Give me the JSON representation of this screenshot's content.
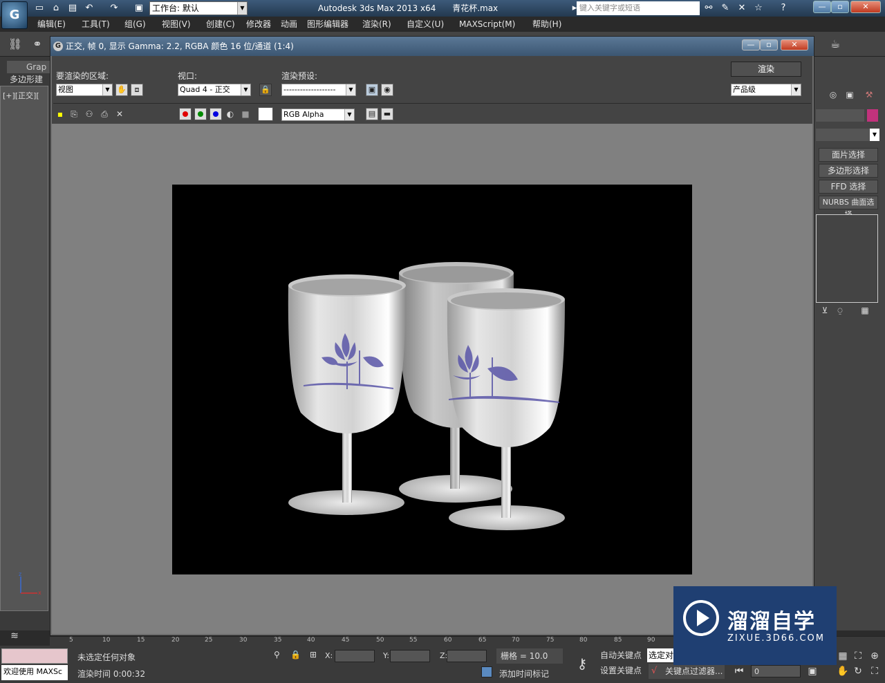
{
  "title_bar": {
    "workspace_label": "工作台: 默认",
    "app_name": "Autodesk 3ds Max  2013 x64",
    "file_name": "青花杯.max",
    "search_placeholder": "键入关键字或短语"
  },
  "menu": {
    "items": [
      "编辑(E)",
      "工具(T)",
      "组(G)",
      "视图(V)",
      "创建(C)",
      "修改器",
      "动画",
      "图形编辑器",
      "渲染(R)",
      "自定义(U)",
      "MAXScript(M)",
      "帮助(H)"
    ]
  },
  "left_panel": {
    "graphite_tab": "Grap",
    "poly_label": "多边形建",
    "viewport_label": "[+][正交]["
  },
  "right_panel": {
    "buttons": [
      "面片选择",
      "多边形选择",
      "FFD 选择",
      "NURBS 曲面选择"
    ]
  },
  "render_window": {
    "title": "正交, 帧 0, 显示 Gamma: 2.2, RGBA 颜色 16 位/通道 (1:4)",
    "area_label": "要渲染的区域:",
    "area_value": "视图",
    "viewport_label": "视口:",
    "viewport_value": "Quad 4 - 正交",
    "preset_label": "渲染预设:",
    "preset_value": "-------------------",
    "render_button": "渲染",
    "quality_value": "产品级",
    "channel_value": "RGB Alpha",
    "channel_colors": {
      "red": "#e00000",
      "green": "#008a00",
      "blue": "#0000e0"
    }
  },
  "timeline": {
    "ticks": [
      "5",
      "10",
      "15",
      "20",
      "25",
      "30",
      "35",
      "40",
      "45",
      "50",
      "55",
      "60",
      "65",
      "70",
      "75",
      "80",
      "85",
      "90"
    ]
  },
  "status": {
    "maxscript_text": "欢迎使用 MAXSc",
    "selection_text": "未选定任何对象",
    "render_time": "渲染时间  0:00:32",
    "x_label": "X:",
    "y_label": "Y:",
    "z_label": "Z:",
    "grid": "栅格 = 10.0",
    "auto_key": "自动关键点",
    "set_key": "设置关键点",
    "selected_dropdown": "选定对",
    "key_filter": "关键点过滤器...",
    "add_time_tag": "添加时间标记",
    "frame_value": "0"
  },
  "watermark": {
    "title": "溜溜自学",
    "subtitle": "ZIXUE.3D66.COM"
  },
  "colors": {
    "porcelain": "#d8d8d8",
    "decoration": "#5a56a8",
    "watermark_bg": "#1f3f72"
  }
}
